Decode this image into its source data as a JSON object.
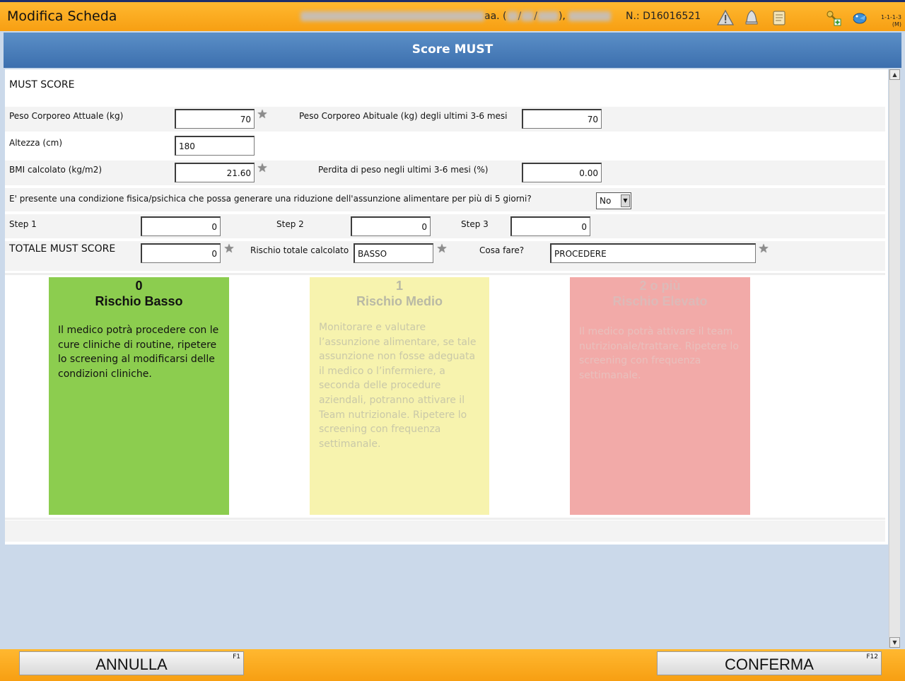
{
  "topbar": {
    "title": "Modifica Scheda",
    "patient_suffix": "aa. (",
    "patient_sep1": "/",
    "patient_sep2": "/",
    "patient_end": "),",
    "card_number": "N.: D16016521",
    "icons": [
      "warning-icon",
      "alarm-bell-icon",
      "notes-icon",
      "key-add-icon",
      "bird-icon"
    ],
    "version_line1": "1-1-1-3",
    "version_line2": "(M)"
  },
  "header": {
    "title": "Score MUST"
  },
  "form": {
    "section_title": "MUST SCORE",
    "peso_attuale_label": "Peso Corporeo Attuale (kg)",
    "peso_attuale_value": "70",
    "peso_abituale_label": "Peso Corporeo Abituale (kg) degli ultimi 3-6 mesi",
    "peso_abituale_value": "70",
    "altezza_label": "Altezza (cm)",
    "altezza_value": "180",
    "bmi_label": "BMI calcolato (kg/m2)",
    "bmi_value": "21.60",
    "perdita_label": "Perdita di peso negli ultimi 3-6 mesi (%)",
    "perdita_value": "0.00",
    "condizione_label": "E' presente una condizione fisica/psichica che possa generare una riduzione dell'assunzione alimentare per più di 5 giorni?",
    "condizione_value": "No",
    "step1_label": "Step 1",
    "step1_value": "0",
    "step2_label": "Step 2",
    "step2_value": "0",
    "step3_label": "Step 3",
    "step3_value": "0",
    "totale_label": "TOTALE MUST SCORE",
    "totale_value": "0",
    "rischio_label": "Rischio totale calcolato",
    "rischio_value": "BASSO",
    "cosa_label": "Cosa fare?",
    "cosa_value": "PROCEDERE"
  },
  "cards": [
    {
      "score": "0",
      "title": "Rischio Basso",
      "text": "Il medico potrà procedere con le cure cliniche di routine, ripetere lo screening al modificarsi delle condizioni cliniche.",
      "color": "#8ccd4f",
      "active": true
    },
    {
      "score": "1",
      "title": "Rischio Medio",
      "text": "Monitorare e valutare l’assunzione alimentare, se tale assunzione non fosse adeguata il medico o l’infermiere, a seconda delle procedure aziendali, potranno attivare il Team nutrizionale. Ripetere lo screening con frequenza settimanale.",
      "color": "#f7f3ae",
      "active": false
    },
    {
      "score": "2 o più",
      "title": "Rischio Elevato",
      "text": "Il medico potrà attivare il team nutrizionale/trattare. Ripetere lo screening con frequenza settimanale.",
      "color": "#f2aaa8",
      "active": false
    }
  ],
  "footer": {
    "annulla_label": "ANNULLA",
    "annulla_key": "F1",
    "conferma_label": "CONFERMA",
    "conferma_key": "F12"
  }
}
